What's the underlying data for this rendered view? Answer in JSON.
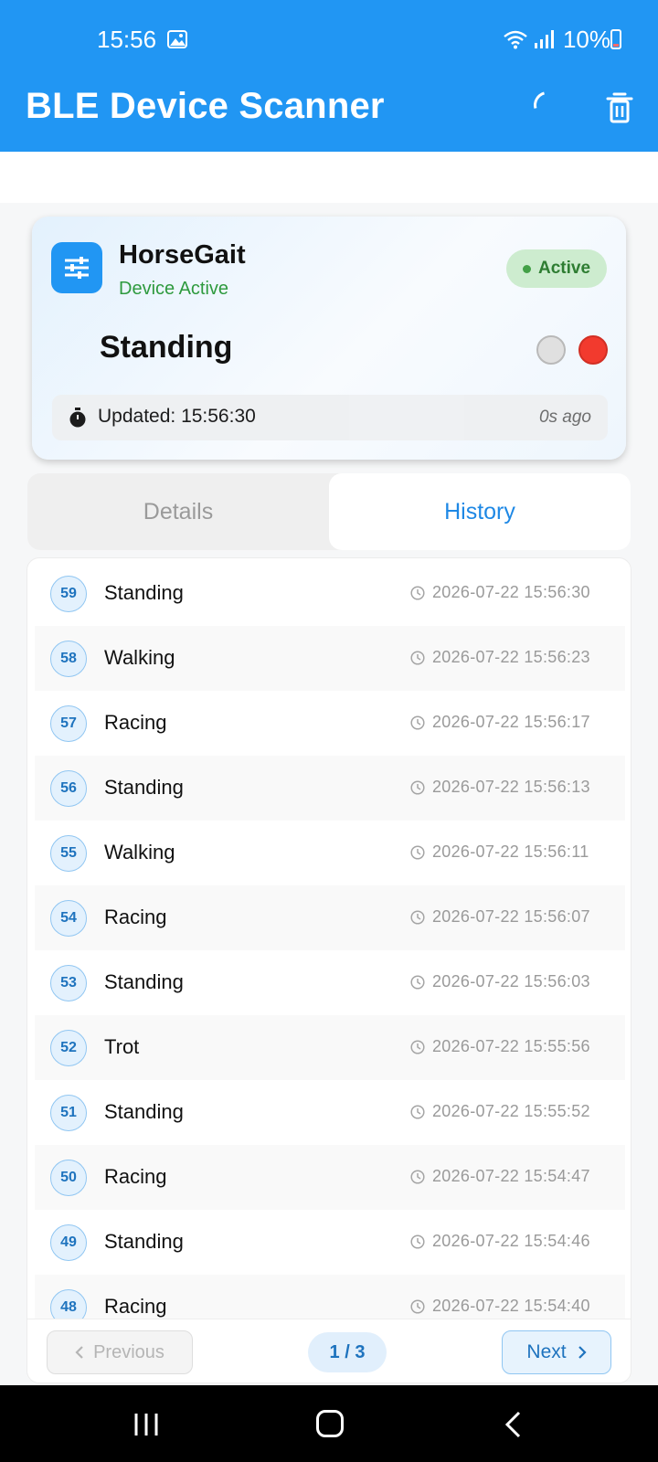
{
  "status_bar": {
    "time": "15:56",
    "battery": "10%"
  },
  "app_bar": {
    "title": "BLE Device Scanner",
    "icons": [
      "loading-spinner",
      "trash-icon"
    ]
  },
  "device": {
    "name": "HorseGait",
    "subtitle": "Device Active",
    "badge": "Active",
    "gait": "Standing",
    "updated": "Updated: 15:56:30",
    "ago": "0s ago"
  },
  "tabs": [
    {
      "label": "Details"
    },
    {
      "label": "History"
    }
  ],
  "active_tab": "History",
  "history": [
    {
      "n": "59",
      "state": "Standing",
      "time": "2026-07-22 15:56:30"
    },
    {
      "n": "58",
      "state": "Walking",
      "time": "2026-07-22 15:56:23"
    },
    {
      "n": "57",
      "state": "Racing",
      "time": "2026-07-22 15:56:17"
    },
    {
      "n": "56",
      "state": "Standing",
      "time": "2026-07-22 15:56:13"
    },
    {
      "n": "55",
      "state": "Walking",
      "time": "2026-07-22 15:56:11"
    },
    {
      "n": "54",
      "state": "Racing",
      "time": "2026-07-22 15:56:07"
    },
    {
      "n": "53",
      "state": "Standing",
      "time": "2026-07-22 15:56:03"
    },
    {
      "n": "52",
      "state": "Trot",
      "time": "2026-07-22 15:55:56"
    },
    {
      "n": "51",
      "state": "Standing",
      "time": "2026-07-22 15:55:52"
    },
    {
      "n": "50",
      "state": "Racing",
      "time": "2026-07-22 15:54:47"
    },
    {
      "n": "49",
      "state": "Standing",
      "time": "2026-07-22 15:54:46"
    },
    {
      "n": "48",
      "state": "Racing",
      "time": "2026-07-22 15:54:40"
    }
  ],
  "pagination": {
    "prev_label": "Previous",
    "page": "1 / 3",
    "next_label": "Next"
  },
  "colors": {
    "primary": "#2196f3",
    "active_green": "#2e9a3e",
    "red": "#f23a2e"
  }
}
